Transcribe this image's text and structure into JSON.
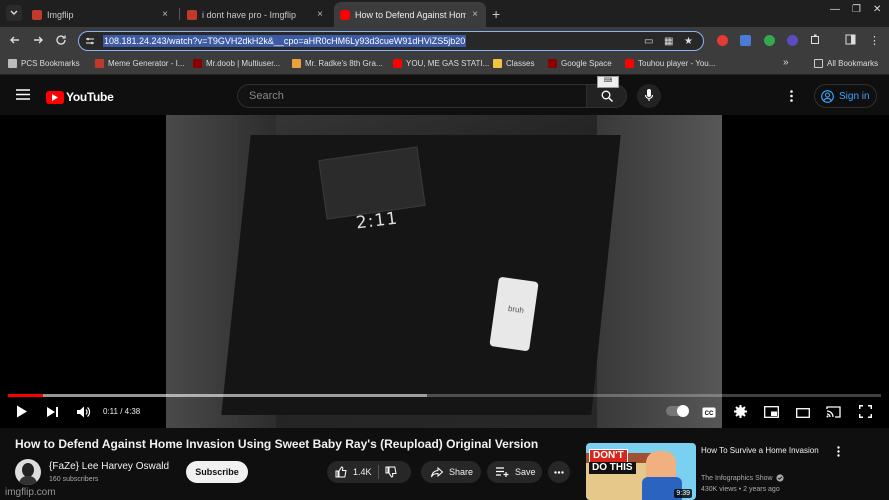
{
  "browser": {
    "tabs": [
      {
        "label": "Imgflip",
        "close": "×",
        "favicon_color": "#c0392b"
      },
      {
        "label": "i dont have pro - Imgflip",
        "close": "×",
        "favicon_color": "#c0392b"
      },
      {
        "label": "How to Defend Against Home I",
        "close": "×",
        "favicon_color": "#ff0000"
      }
    ],
    "new_tab": "+",
    "window_controls": {
      "minimize": "—",
      "restore": "❐",
      "close": "✕"
    },
    "url": "108.181.24.243/watch?v=T9GVH2dkH2k&__cpo=aHR0cHM6Ly93d3cueW91dHViZS5jb20",
    "bookmarks": [
      {
        "label": "PCS Bookmarks",
        "color": "#bbbbbb"
      },
      {
        "label": "Meme Generator - I...",
        "color": "#c0392b"
      },
      {
        "label": "Mr.doob | Multiuser...",
        "color": "#8b0000"
      },
      {
        "label": "Mr. Radke's 8th Gra...",
        "color": "#e8a33d"
      },
      {
        "label": "YOU, ME GAS STATI...",
        "color": "#ff0000"
      },
      {
        "label": "Classes",
        "color": "#f4c542"
      },
      {
        "label": "Google Space",
        "color": "#8b0000"
      },
      {
        "label": "Touhou player - You...",
        "color": "#ff0000"
      }
    ],
    "bookmarks_overflow": "»",
    "all_bookmarks": "All Bookmarks"
  },
  "youtube": {
    "logo_text": "YouTube",
    "search_placeholder": "Search",
    "signin_label": "Sign in",
    "keyboard_badge": "⌨"
  },
  "player": {
    "clock_text": "2:11",
    "card_text": "bruh",
    "time_display": "0:11 / 4:38",
    "progress_fraction": 0.04,
    "buffered_fraction": 0.48
  },
  "video": {
    "title": "How to Defend Against Home Invasion Using Sweet Baby Ray's (Reupload) Original Version",
    "channel_name": "{FaZe} Lee Harvey Oswald",
    "subscribers": "160 subscribers",
    "subscribe_label": "Subscribe",
    "likes": "1.4K",
    "share_label": "Share",
    "save_label": "Save"
  },
  "recommendation": {
    "thumb_text_1": "DON'T",
    "thumb_text_2": "DO THIS",
    "duration": "9:39",
    "title": "How To Survive a Home Invasion",
    "channel": "The Infographics Show",
    "meta": "430K views • 2 years ago"
  },
  "watermark": "imgflip.com",
  "colors": {
    "accent_red": "#ff0000",
    "link_blue": "#3ea6ff",
    "url_highlight": "#3d5aa5"
  }
}
